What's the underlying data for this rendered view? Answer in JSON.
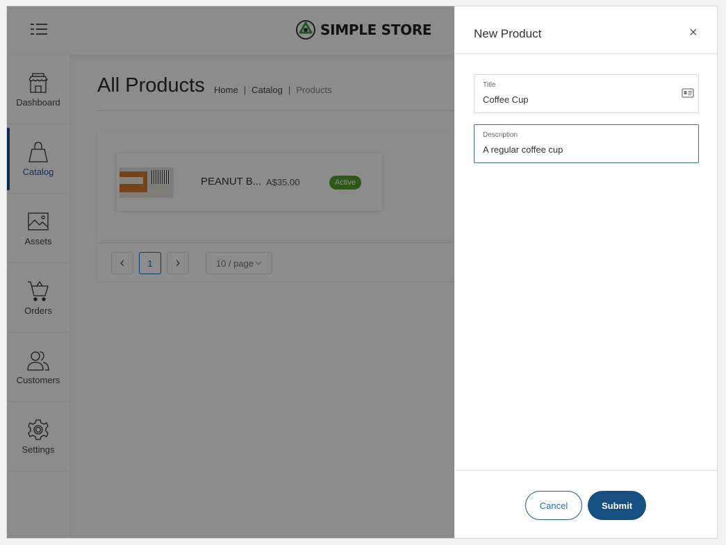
{
  "header": {
    "brand": "SIMPLE STORE",
    "menu_icon": "hamburger-icon",
    "logo_icon": "recycle-logo-icon"
  },
  "sidebar": {
    "items": [
      {
        "label": "Dashboard",
        "icon": "storefront-icon",
        "active": false
      },
      {
        "label": "Catalog",
        "icon": "shopping-bag-icon",
        "active": true
      },
      {
        "label": "Assets",
        "icon": "image-icon",
        "active": false
      },
      {
        "label": "Orders",
        "icon": "shopping-cart-icon",
        "active": false
      },
      {
        "label": "Customers",
        "icon": "users-icon",
        "active": false
      },
      {
        "label": "Settings",
        "icon": "gear-icon",
        "active": false
      }
    ]
  },
  "main": {
    "title": "All Products",
    "breadcrumb": [
      "Home",
      "Catalog",
      "Products"
    ],
    "products": [
      {
        "name": "PEANUT B...",
        "price": "A$35.00",
        "status": "Active"
      }
    ],
    "pagination": {
      "current_page": "1",
      "page_size": "10 / page"
    }
  },
  "drawer": {
    "title": "New Product",
    "close_icon": "close-icon",
    "fields": {
      "title": {
        "label": "Title",
        "value": "Coffee Cup",
        "icon": "contact-card-icon"
      },
      "description": {
        "label": "Description",
        "value": "A regular coffee cup"
      }
    },
    "cancel_label": "Cancel",
    "submit_label": "Submit"
  },
  "colors": {
    "accent": "#144f80",
    "active_nav": "#1f5fa8",
    "badge_active": "#52a329",
    "overlay": "rgba(0,0,0,0.45)"
  }
}
